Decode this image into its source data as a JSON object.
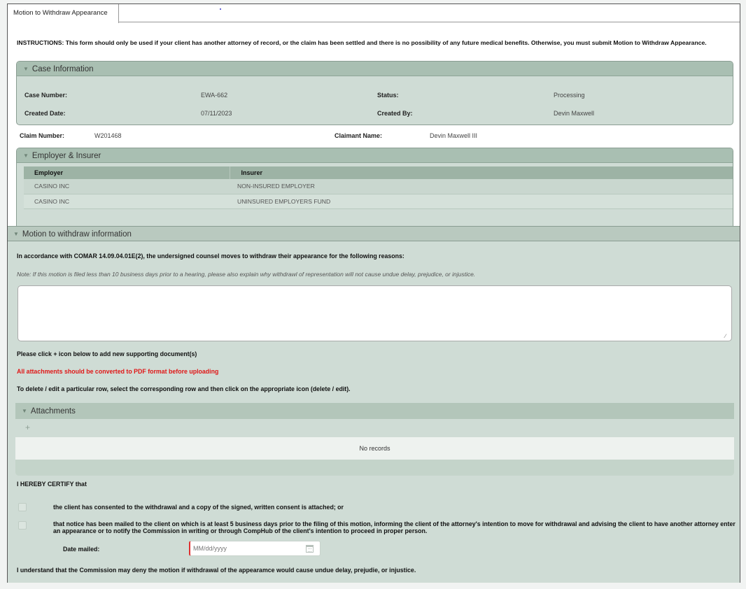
{
  "tab": {
    "label": "Motion to Withdraw Appearance"
  },
  "instructions": "INSTRUCTIONS: This form should only be used if your client has another attorney of record, or the claim has been settled and there is no possibility of any future medical benefits. Otherwise, you must submit Motion to Withdraw Appearance.",
  "case_info": {
    "title": "Case Information",
    "case_number_label": "Case Number:",
    "case_number": "EWA-662",
    "status_label": "Status:",
    "status": "Processing",
    "created_date_label": "Created Date:",
    "created_date": "07/11/2023",
    "created_by_label": "Created By:",
    "created_by": "Devin Maxwell"
  },
  "claim": {
    "claim_number_label": "Claim Number:",
    "claim_number": "W201468",
    "claimant_name_label": "Claimant Name:",
    "claimant_name": "Devin Maxwell III"
  },
  "employer_insurer": {
    "title": "Employer & Insurer",
    "columns": [
      "Employer",
      "Insurer"
    ],
    "rows": [
      [
        "CASINO INC",
        "NON-INSURED EMPLOYER"
      ],
      [
        "CASINO INC",
        "UNINSURED EMPLOYERS FUND"
      ]
    ]
  },
  "motion": {
    "title": "Motion to withdraw information",
    "accordance": "In accordance with COMAR 14.09.04.01E(2), the undersigned counsel moves to withdraw their appearance for the following reasons:",
    "note": "Note: If this motion is filed less than 10 business days prior to a hearing, please also explain why withdrawl of representation will not cause undue delay, prejudice, or injustice.",
    "reasons_value": "",
    "click_instruction": "Please click + icon below to add new supporting document(s)",
    "pdf_warning": "All attachments should be converted to PDF format before uploading",
    "delete_instruction": "To delete / edit a particular row, select the corresponding row and then click on the appropriate icon (delete / edit).",
    "warning_color": "#e01616"
  },
  "attachments": {
    "title": "Attachments",
    "add_icon": "+",
    "empty_text": "No records"
  },
  "certify": {
    "heading": "I HEREBY CERTIFY that",
    "option1": "the client has consented to the withdrawal and a copy of the signed, written consent is attached; or",
    "option2": "that notice has been mailed to the client on which is at least 5 business days prior to the filing of this motion, informing the client of the attorney's intention to move for withdrawal and advising the client to have another attorney enter an appearance or to notify the Commission in writing or through CompHub of the client's intention to proceed in proper person.",
    "date_label": "Date mailed:",
    "date_placeholder": "MM/dd/yyyy",
    "understand": "I understand that the Commission may deny the motion if withdrawal of the appearamce would cause undue delay, prejudie, or injustice."
  },
  "icons": {
    "chevron": "chevron-down-icon",
    "calendar": "calendar-icon",
    "add": "plus-icon"
  }
}
